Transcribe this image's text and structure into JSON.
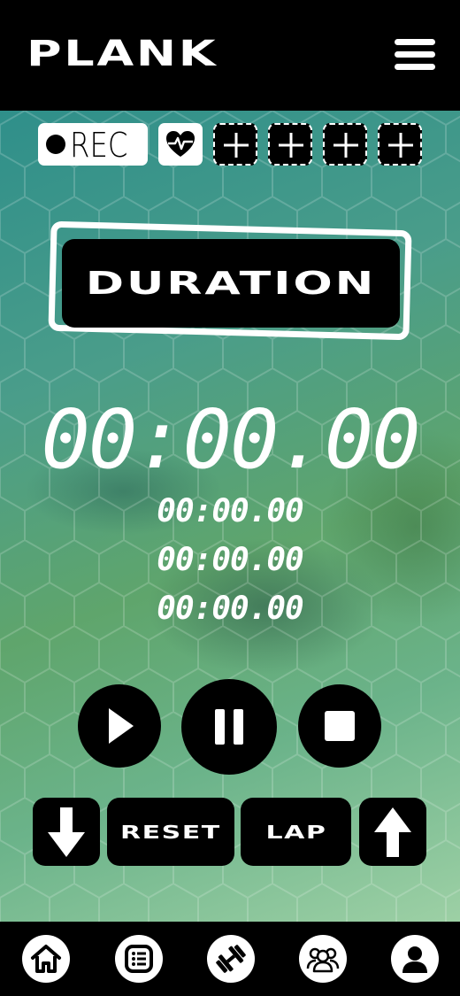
{
  "header": {
    "title": "PLANK",
    "menu_icon": "hamburger-menu-icon"
  },
  "toolbar": {
    "rec_label": "REC",
    "rec_icon": "record-dot-icon",
    "heart_icon": "heart-rate-icon",
    "add_slots": [
      "plus-icon",
      "plus-icon",
      "plus-icon",
      "plus-icon"
    ]
  },
  "timer": {
    "label": "DURATION",
    "main": "00:00.00",
    "laps": [
      "00:00.00",
      "00:00.00",
      "00:00.00"
    ]
  },
  "controls": {
    "play_icon": "play-icon",
    "pause_icon": "pause-icon",
    "stop_icon": "stop-icon",
    "down_icon": "arrow-down-icon",
    "reset_label": "RESET",
    "lap_label": "LAP",
    "up_icon": "arrow-up-icon"
  },
  "nav": {
    "items": [
      "home-icon",
      "list-icon",
      "dumbbell-icon",
      "community-icon",
      "profile-icon"
    ]
  },
  "colors": {
    "background": "#000000",
    "foreground": "#ffffff",
    "gradient_start": "#2f8f8a",
    "gradient_end": "#9dd0a5"
  }
}
